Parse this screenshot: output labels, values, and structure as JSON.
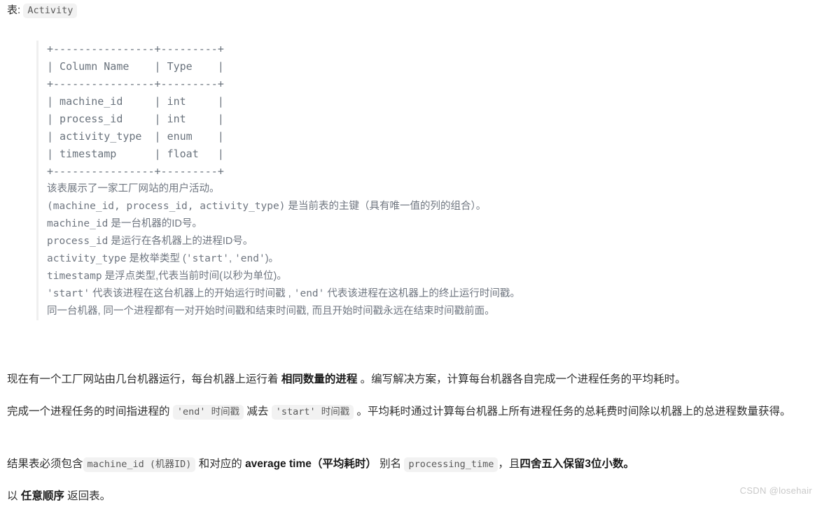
{
  "caption": {
    "label": "表:",
    "table_name": "Activity"
  },
  "schema_table": {
    "ascii": "+----------------+---------+\n| Column Name    | Type    |\n+----------------+---------+\n| machine_id     | int     |\n| process_id     | int     |\n| activity_type  | enum    |\n| timestamp      | float   |\n+----------------+---------+",
    "columns": [
      "Column Name",
      "Type"
    ],
    "rows": [
      {
        "name": "machine_id",
        "type": "int"
      },
      {
        "name": "process_id",
        "type": "int"
      },
      {
        "name": "activity_type",
        "type": "enum"
      },
      {
        "name": "timestamp",
        "type": "float"
      }
    ]
  },
  "schema_notes": {
    "line1": "该表展示了一家工厂网站的用户活动。",
    "line2_code": "(machine_id, process_id, activity_type)",
    "line2_text": " 是当前表的主键（具有唯一值的列的组合）。",
    "line3_code": "machine_id",
    "line3_text": " 是一台机器的ID号。",
    "line4_code": "process_id",
    "line4_text": " 是运行在各机器上的进程ID号。",
    "line5_code": "activity_type",
    "line5_text": " 是枚举类型 (",
    "line5_code2": "'start'",
    "line5_text2": ", ",
    "line5_code3": "'end'",
    "line5_text3": ")。",
    "line6_code": "timestamp",
    "line6_text": " 是浮点类型,代表当前时间(以秒为单位)。",
    "line7_code": "'start'",
    "line7_text": " 代表该进程在这台机器上的开始运行时间戳 , ",
    "line7_code2": "'end'",
    "line7_text2": " 代表该进程在这机器上的终止运行时间戳。",
    "line8": "同一台机器, 同一个进程都有一对开始时间戳和结束时间戳, 而且开始时间戳永远在结束时间戳前面。"
  },
  "paragraphs": {
    "p1_a": "现在有一个工厂网站由几台机器运行，每台机器上运行着 ",
    "p1_bold": "相同数量的进程",
    "p1_b": " 。编写解决方案，计算每台机器各自完成一个进程任务的平均耗时。",
    "p2_a": "完成一个进程任务的时间指进程的 ",
    "p2_code1": "'end' 时间戳",
    "p2_b": " 减去 ",
    "p2_code2": "'start' 时间戳",
    "p2_c": " 。平均耗时通过计算每台机器上所有进程任务的总耗费时间除以机器上的总进程数量获得。",
    "p3_a": "结果表必须包含",
    "p3_code1": "machine_id (机器ID)",
    "p3_b": " 和对应的 ",
    "p3_bold1": "average time（平均耗时）",
    "p3_c": " 别名 ",
    "p3_code2": "processing_time",
    "p3_d": "，且",
    "p3_bold2": "四舍五入保留3位小数。",
    "p4_a": "以 ",
    "p4_bold": "任意顺序",
    "p4_b": " 返回表。"
  },
  "watermark": {
    "text": "CSDN @losehair"
  },
  "colors": {
    "code_bg": "#f2f2f2",
    "quote_border": "#efefef",
    "mono_text": "#6a737d",
    "body_text": "#2f2f2f",
    "watermark": "#c9c9c9"
  }
}
